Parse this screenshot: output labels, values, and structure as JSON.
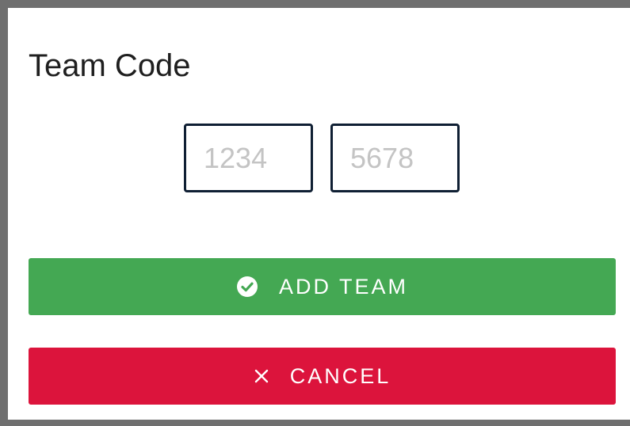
{
  "dialog": {
    "title": "Team Code",
    "inputs": [
      {
        "value": "",
        "placeholder": "1234"
      },
      {
        "value": "",
        "placeholder": "5678"
      }
    ]
  },
  "buttons": {
    "add_label": "ADD TEAM",
    "add_icon": "check-circle-icon",
    "add_color": "#44a853",
    "cancel_label": "CANCEL",
    "cancel_icon": "close-icon",
    "cancel_color": "#dc143c"
  }
}
